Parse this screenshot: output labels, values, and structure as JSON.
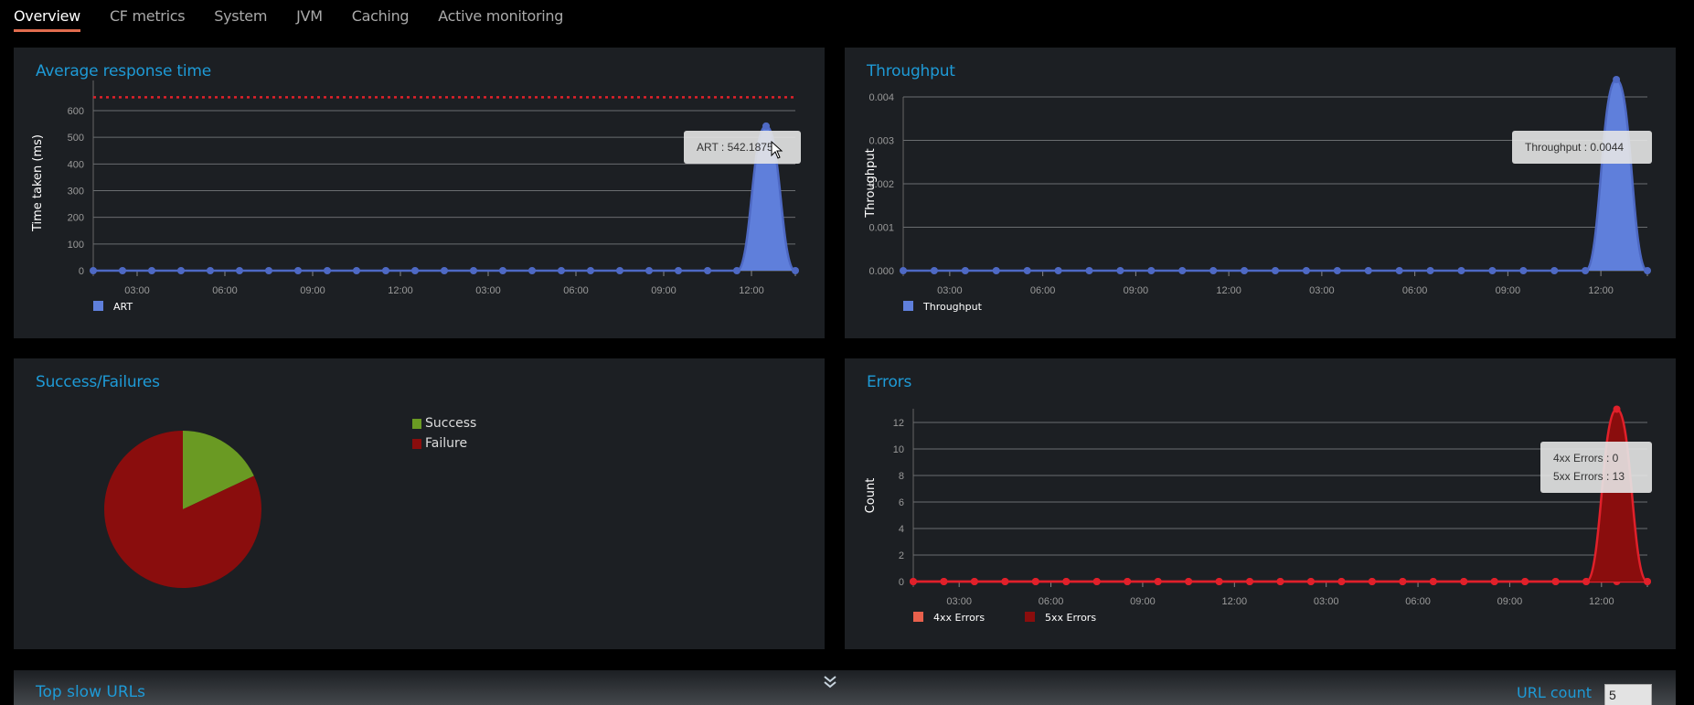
{
  "tabs": [
    {
      "label": "Overview",
      "active": true
    },
    {
      "label": "CF metrics",
      "active": false
    },
    {
      "label": "System",
      "active": false
    },
    {
      "label": "JVM",
      "active": false
    },
    {
      "label": "Caching",
      "active": false
    },
    {
      "label": "Active monitoring",
      "active": false
    }
  ],
  "colors": {
    "accent": "#1e9ad6",
    "tab_underline": "#e06c4e",
    "panel_bg": "#1c1f23",
    "series_blue": "#5f7fdb",
    "success_green": "#6a9a23",
    "failure_red": "#8a0d0d",
    "error_4xx": "#e8604c",
    "error_5xx": "#8a0d0d",
    "threshold_red": "#e0202a"
  },
  "panels": {
    "art": {
      "title": "Average response time",
      "tooltip": "ART : 542.1875"
    },
    "throughput": {
      "title": "Throughput",
      "tooltip": "Throughput : 0.0044"
    },
    "success": {
      "title": "Success/Failures"
    },
    "errors": {
      "title": "Errors",
      "tooltip_lines": [
        "4xx Errors : 0",
        "5xx Errors : 13"
      ]
    }
  },
  "bottom": {
    "title": "Top slow URLs",
    "url_count_label": "URL count",
    "url_count_value": "5",
    "collapse_icon": "double-chevron-down-icon"
  },
  "chart_data": [
    {
      "id": "art",
      "type": "area",
      "title": "Average response time",
      "xlabel": "",
      "ylabel": "Time taken (ms)",
      "x_ticks": [
        "03:00",
        "06:00",
        "09:00",
        "12:00",
        "03:00",
        "06:00",
        "09:00",
        "12:00"
      ],
      "y_ticks": [
        0,
        100,
        200,
        300,
        400,
        500,
        600
      ],
      "ylim": [
        0,
        650
      ],
      "threshold": 650,
      "grid": true,
      "legend": "bottom-left",
      "series": [
        {
          "name": "ART",
          "color": "#5f7fdb",
          "values": [
            0,
            0,
            0,
            0,
            0,
            0,
            0,
            0,
            0,
            0,
            0,
            0,
            0,
            0,
            0,
            0,
            0,
            0,
            0,
            0,
            0,
            0,
            0,
            542.1875,
            0
          ]
        }
      ]
    },
    {
      "id": "throughput",
      "type": "area",
      "title": "Throughput",
      "xlabel": "",
      "ylabel": "Throughput",
      "x_ticks": [
        "03:00",
        "06:00",
        "09:00",
        "12:00",
        "03:00",
        "06:00",
        "09:00",
        "12:00"
      ],
      "y_ticks": [
        "0.000",
        "0.001",
        "0.002",
        "0.003",
        "0.004"
      ],
      "ylim": [
        0,
        0.004
      ],
      "grid": true,
      "legend": "bottom-left",
      "series": [
        {
          "name": "Throughput",
          "color": "#5f7fdb",
          "values": [
            0,
            0,
            0,
            0,
            0,
            0,
            0,
            0,
            0,
            0,
            0,
            0,
            0,
            0,
            0,
            0,
            0,
            0,
            0,
            0,
            0,
            0,
            0,
            0.0044,
            0
          ]
        }
      ]
    },
    {
      "id": "success",
      "type": "pie",
      "title": "Success/Failures",
      "legend": "top-right",
      "slices": [
        {
          "name": "Success",
          "value": 18,
          "color": "#6a9a23"
        },
        {
          "name": "Failure",
          "value": 82,
          "color": "#8a0d0d"
        }
      ]
    },
    {
      "id": "errors",
      "type": "area",
      "title": "Errors",
      "xlabel": "",
      "ylabel": "Count",
      "x_ticks": [
        "03:00",
        "06:00",
        "09:00",
        "12:00",
        "03:00",
        "06:00",
        "09:00",
        "12:00"
      ],
      "y_ticks": [
        0,
        2,
        4,
        6,
        8,
        10,
        12
      ],
      "ylim": [
        0,
        13
      ],
      "grid": true,
      "legend": "bottom-left",
      "series": [
        {
          "name": "4xx Errors",
          "color": "#e8604c",
          "values": [
            0,
            0,
            0,
            0,
            0,
            0,
            0,
            0,
            0,
            0,
            0,
            0,
            0,
            0,
            0,
            0,
            0,
            0,
            0,
            0,
            0,
            0,
            0,
            0,
            0
          ]
        },
        {
          "name": "5xx Errors",
          "color": "#8a0d0d",
          "values": [
            0,
            0,
            0,
            0,
            0,
            0,
            0,
            0,
            0,
            0,
            0,
            0,
            0,
            0,
            0,
            0,
            0,
            0,
            0,
            0,
            0,
            0,
            0,
            13,
            0
          ]
        }
      ]
    }
  ]
}
